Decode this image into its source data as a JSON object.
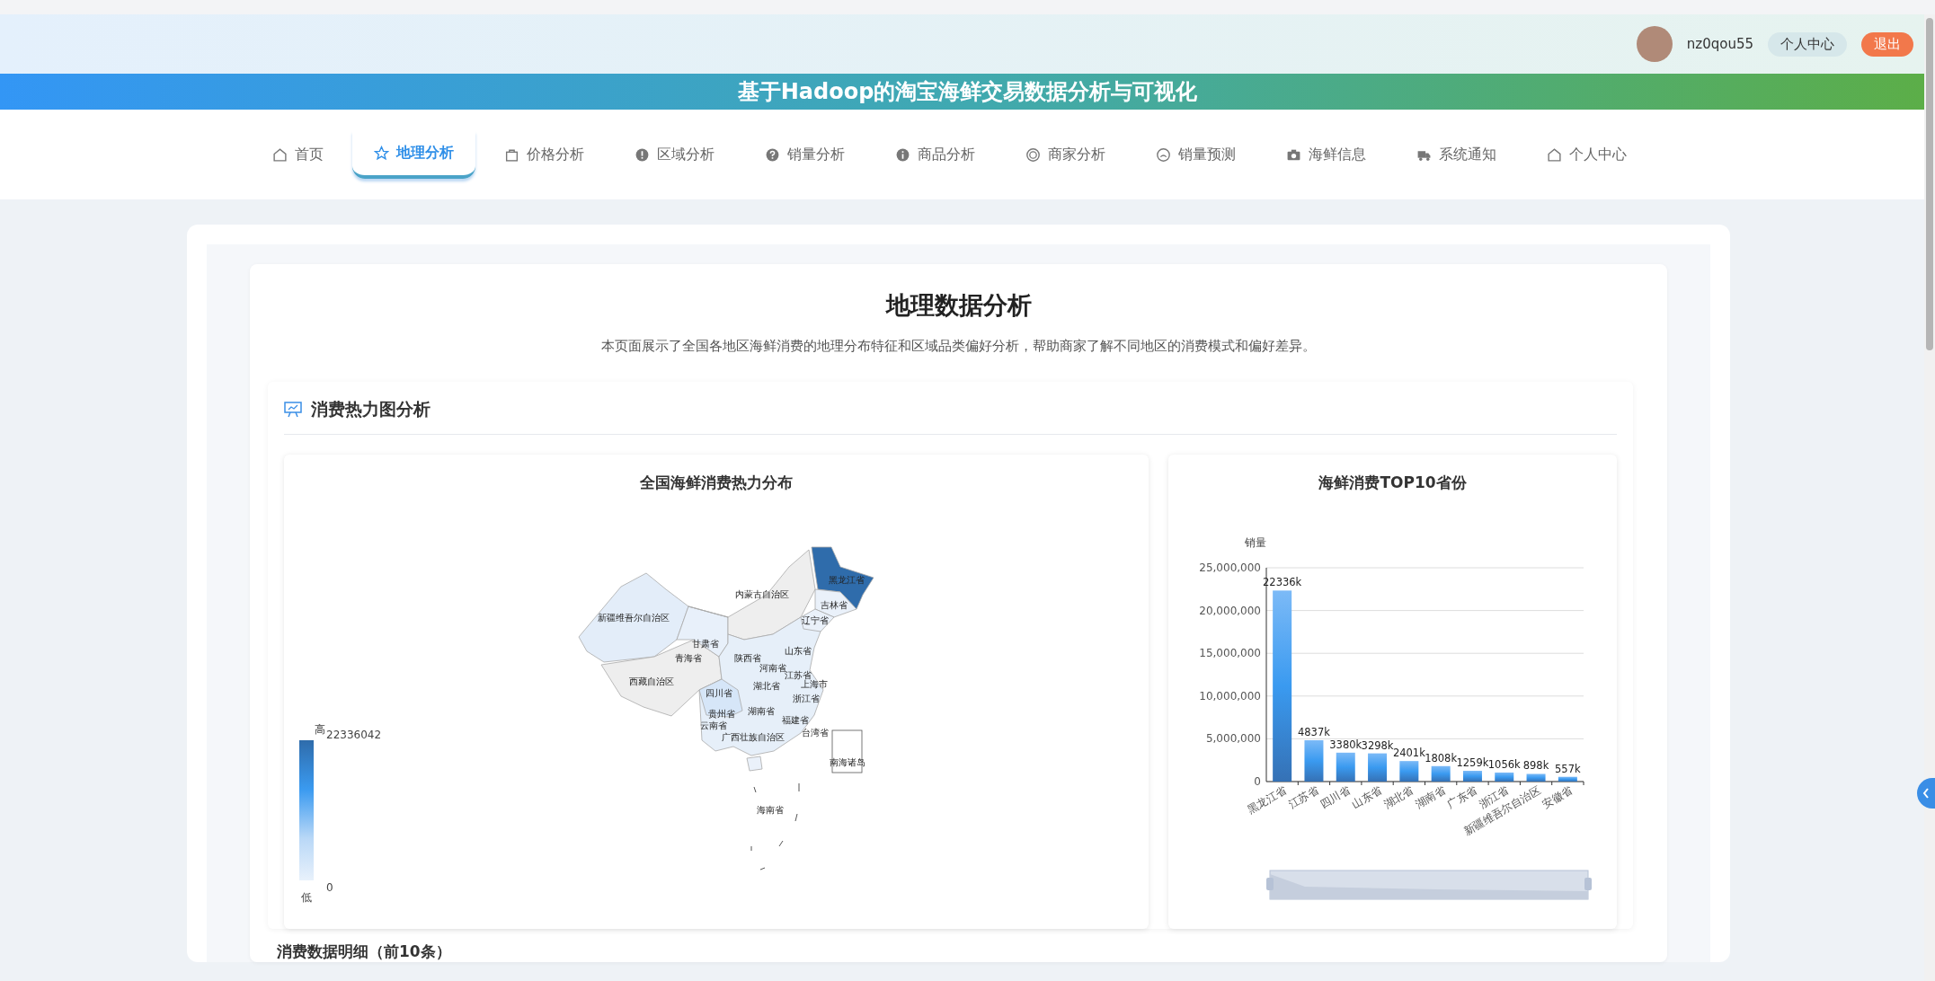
{
  "header": {
    "title": "基于Hadoop的淘宝海鲜交易数据分析与可视化",
    "username": "nz0qou55",
    "profile_button": "个人中心",
    "logout_button": "退出"
  },
  "nav": {
    "items": [
      {
        "label": "首页",
        "selected": false
      },
      {
        "label": "地理分析",
        "selected": true
      },
      {
        "label": "价格分析",
        "selected": false
      },
      {
        "label": "区域分析",
        "selected": false
      },
      {
        "label": "销量分析",
        "selected": false
      },
      {
        "label": "商品分析",
        "selected": false
      },
      {
        "label": "商家分析",
        "selected": false
      },
      {
        "label": "销量预测",
        "selected": false
      },
      {
        "label": "海鲜信息",
        "selected": false
      },
      {
        "label": "系统通知",
        "selected": false
      },
      {
        "label": "个人中心",
        "selected": false
      }
    ]
  },
  "page": {
    "title": "地理数据分析",
    "description": "本页面展示了全国各地区海鲜消费的地理分布特征和区域品类偏好分析，帮助商家了解不同地区的消费模式和偏好差异。"
  },
  "section": {
    "title": "消费热力图分析",
    "map": {
      "title": "全国海鲜消费热力分布",
      "legend": {
        "high_label": "高",
        "max": "22336042",
        "min": "0",
        "low_label": "低"
      },
      "labels": [
        "黑龙江省",
        "内蒙古自治区",
        "吉林省",
        "新疆维吾尔自治区",
        "辽宁省",
        "甘肃省",
        "青海省",
        "山东省",
        "陕西省",
        "河南省",
        "江苏省",
        "西藏自治区",
        "湖北省",
        "上海市",
        "四川省",
        "浙江省",
        "贵州省",
        "湖南省",
        "福建省",
        "云南省",
        "台湾省",
        "广西壮族自治区",
        "南海诸岛",
        "海南省"
      ]
    },
    "bar": {
      "chart_data": {
        "type": "bar",
        "title": "海鲜消费TOP10省份",
        "ylabel": "销量",
        "categories": [
          "黑龙江省",
          "江苏省",
          "四川省",
          "山东省",
          "湖北省",
          "湖南省",
          "广东省",
          "浙江省",
          "新疆维吾尔自治区",
          "安徽省"
        ],
        "series": [
          {
            "color": "#3a9af0",
            "values": [
              22336000,
              4837000,
              3380000,
              3298000,
              2401000,
              1808000,
              1259000,
              1056000,
              898000,
              557000
            ]
          }
        ],
        "ylim": [
          0,
          25000000
        ],
        "grid": true,
        "yticks": [
          {
            "value": 0,
            "label": "0"
          },
          {
            "value": 5000000,
            "label": "5,000,000"
          },
          {
            "value": 10000000,
            "label": "10,000,000"
          },
          {
            "value": 15000000,
            "label": "15,000,000"
          },
          {
            "value": 20000000,
            "label": "20,000,000"
          },
          {
            "value": 25000000,
            "label": "25,000,000"
          }
        ],
        "value_labels": [
          "22336k",
          "4837k",
          "3380k",
          "3298k",
          "2401k",
          "1808k",
          "1259k",
          "1056k",
          "898k",
          "557k"
        ]
      }
    }
  },
  "details": {
    "title": "消费数据明细（前10条）"
  }
}
